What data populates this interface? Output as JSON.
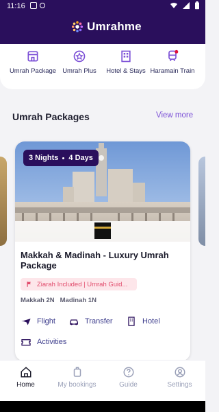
{
  "status": {
    "time": "11:16"
  },
  "app": {
    "name": "Umrahme"
  },
  "quick_actions": [
    {
      "label": "Umrah Package",
      "icon": "building-icon"
    },
    {
      "label": "Umrah Plus",
      "icon": "badge-star-icon"
    },
    {
      "label": "Hotel & Stays",
      "icon": "hotel-icon"
    },
    {
      "label": "Haramain Train",
      "icon": "train-icon"
    }
  ],
  "section": {
    "title": "Umrah Packages",
    "view_more": "View more"
  },
  "package": {
    "nights": "3 Nights",
    "days": "4 Days",
    "title": "Makkah & Madinah - Luxury Umrah Package",
    "ziarah": "Ziarah Included | Umrah Guid...",
    "cities": [
      "Makkah 2N",
      "Madinah 1N"
    ],
    "features": [
      "Flight",
      "Transfer",
      "Hotel",
      "Activities"
    ]
  },
  "bottom_nav": {
    "home": "Home",
    "bookings": "My bookings",
    "guide": "Guide",
    "settings": "Settings"
  },
  "colors": {
    "brand": "#2a0f5c",
    "accent": "#7b4fd6",
    "pink": "#e14a6b"
  }
}
